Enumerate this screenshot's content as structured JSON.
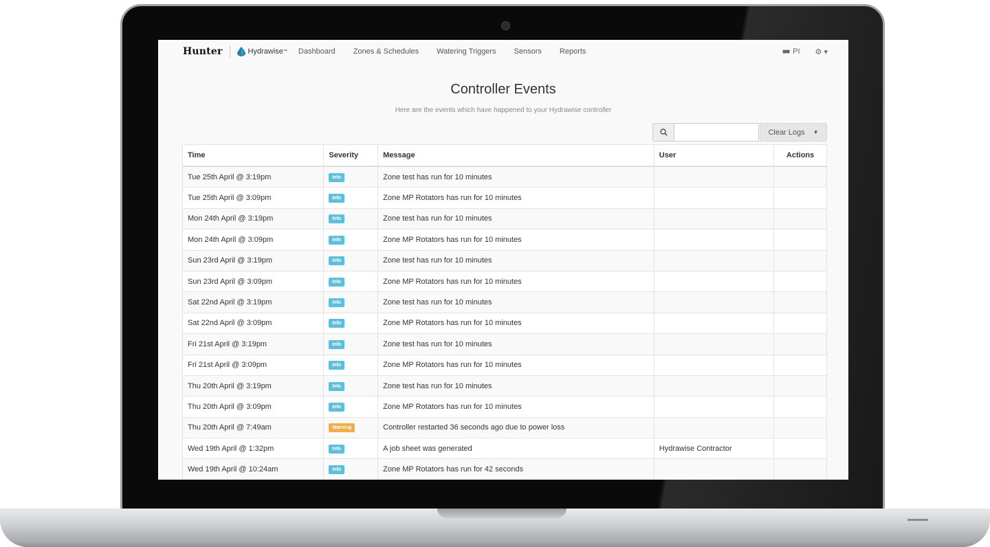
{
  "nav": {
    "hunter_logo": "Hunter",
    "hydrawise_logo": "Hydrawise",
    "hydrawise_tm": "™",
    "links": [
      "Dashboard",
      "Zones & Schedules",
      "Watering Triggers",
      "Sensors",
      "Reports"
    ],
    "account_label": "PI",
    "settings_icon": "gears-icon"
  },
  "page": {
    "title": "Controller Events",
    "subtitle": "Here are the events which have happened to your Hydrawise controller"
  },
  "toolbar": {
    "search_placeholder": "",
    "search_icon": "search-icon",
    "clear_logs_label": "Clear Logs"
  },
  "table": {
    "headers": [
      "Time",
      "Severity",
      "Message",
      "User",
      "Actions"
    ],
    "rows": [
      {
        "time": "Tue 25th April @ 3:19pm",
        "severity": "Info",
        "message": "Zone test has run for 10 minutes",
        "user": ""
      },
      {
        "time": "Tue 25th April @ 3:09pm",
        "severity": "Info",
        "message": "Zone MP Rotators has run for 10 minutes",
        "user": ""
      },
      {
        "time": "Mon 24th April @ 3:19pm",
        "severity": "Info",
        "message": "Zone test has run for 10 minutes",
        "user": ""
      },
      {
        "time": "Mon 24th April @ 3:09pm",
        "severity": "Info",
        "message": "Zone MP Rotators has run for 10 minutes",
        "user": ""
      },
      {
        "time": "Sun 23rd April @ 3:19pm",
        "severity": "Info",
        "message": "Zone test has run for 10 minutes",
        "user": ""
      },
      {
        "time": "Sun 23rd April @ 3:09pm",
        "severity": "Info",
        "message": "Zone MP Rotators has run for 10 minutes",
        "user": ""
      },
      {
        "time": "Sat 22nd April @ 3:19pm",
        "severity": "Info",
        "message": "Zone test has run for 10 minutes",
        "user": ""
      },
      {
        "time": "Sat 22nd April @ 3:09pm",
        "severity": "Info",
        "message": "Zone MP Rotators has run for 10 minutes",
        "user": ""
      },
      {
        "time": "Fri 21st April @ 3:19pm",
        "severity": "Info",
        "message": "Zone test has run for 10 minutes",
        "user": ""
      },
      {
        "time": "Fri 21st April @ 3:09pm",
        "severity": "Info",
        "message": "Zone MP Rotators has run for 10 minutes",
        "user": ""
      },
      {
        "time": "Thu 20th April @ 3:19pm",
        "severity": "Info",
        "message": "Zone test has run for 10 minutes",
        "user": ""
      },
      {
        "time": "Thu 20th April @ 3:09pm",
        "severity": "Info",
        "message": "Zone MP Rotators has run for 10 minutes",
        "user": ""
      },
      {
        "time": "Thu 20th April @ 7:49am",
        "severity": "Warning",
        "message": "Controller restarted 36 seconds ago due to power loss",
        "user": ""
      },
      {
        "time": "Wed 19th April @ 1:32pm",
        "severity": "Info",
        "message": "A job sheet was generated",
        "user": "Hydrawise Contractor"
      },
      {
        "time": "Wed 19th April @ 10:24am",
        "severity": "Info",
        "message": "Zone MP Rotators has run for 42 seconds",
        "user": ""
      }
    ]
  },
  "colors": {
    "info_badge": "#5bc0de",
    "warning_badge": "#f0ad4e",
    "hydrawise_drop": "#1f7fc0"
  }
}
